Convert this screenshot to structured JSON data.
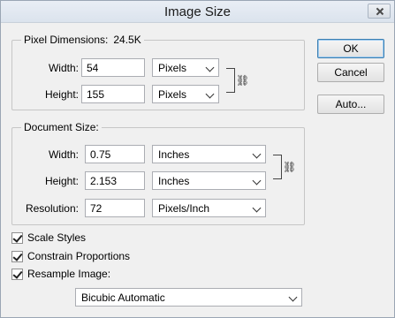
{
  "window": {
    "title": "Image Size"
  },
  "pixel_dimensions": {
    "label": "Pixel Dimensions:",
    "value": "24.5K",
    "width": {
      "label": "Width:",
      "value": "54",
      "unit": "Pixels"
    },
    "height": {
      "label": "Height:",
      "value": "155",
      "unit": "Pixels"
    }
  },
  "document_size": {
    "label": "Document Size:",
    "width": {
      "label": "Width:",
      "value": "0.75",
      "unit": "Inches"
    },
    "height": {
      "label": "Height:",
      "value": "2.153",
      "unit": "Inches"
    },
    "resolution": {
      "label": "Resolution:",
      "value": "72",
      "unit": "Pixels/Inch"
    }
  },
  "buttons": {
    "ok": "OK",
    "cancel": "Cancel",
    "auto": "Auto..."
  },
  "options": {
    "scale_styles": {
      "label": "Scale Styles",
      "checked": true
    },
    "constrain_proportions": {
      "label": "Constrain Proportions",
      "checked": true
    },
    "resample_image": {
      "label": "Resample Image:",
      "checked": true
    },
    "resample_method": "Bicubic Automatic"
  },
  "icons": {
    "link": "chain-link-icon",
    "close": "close-icon"
  }
}
